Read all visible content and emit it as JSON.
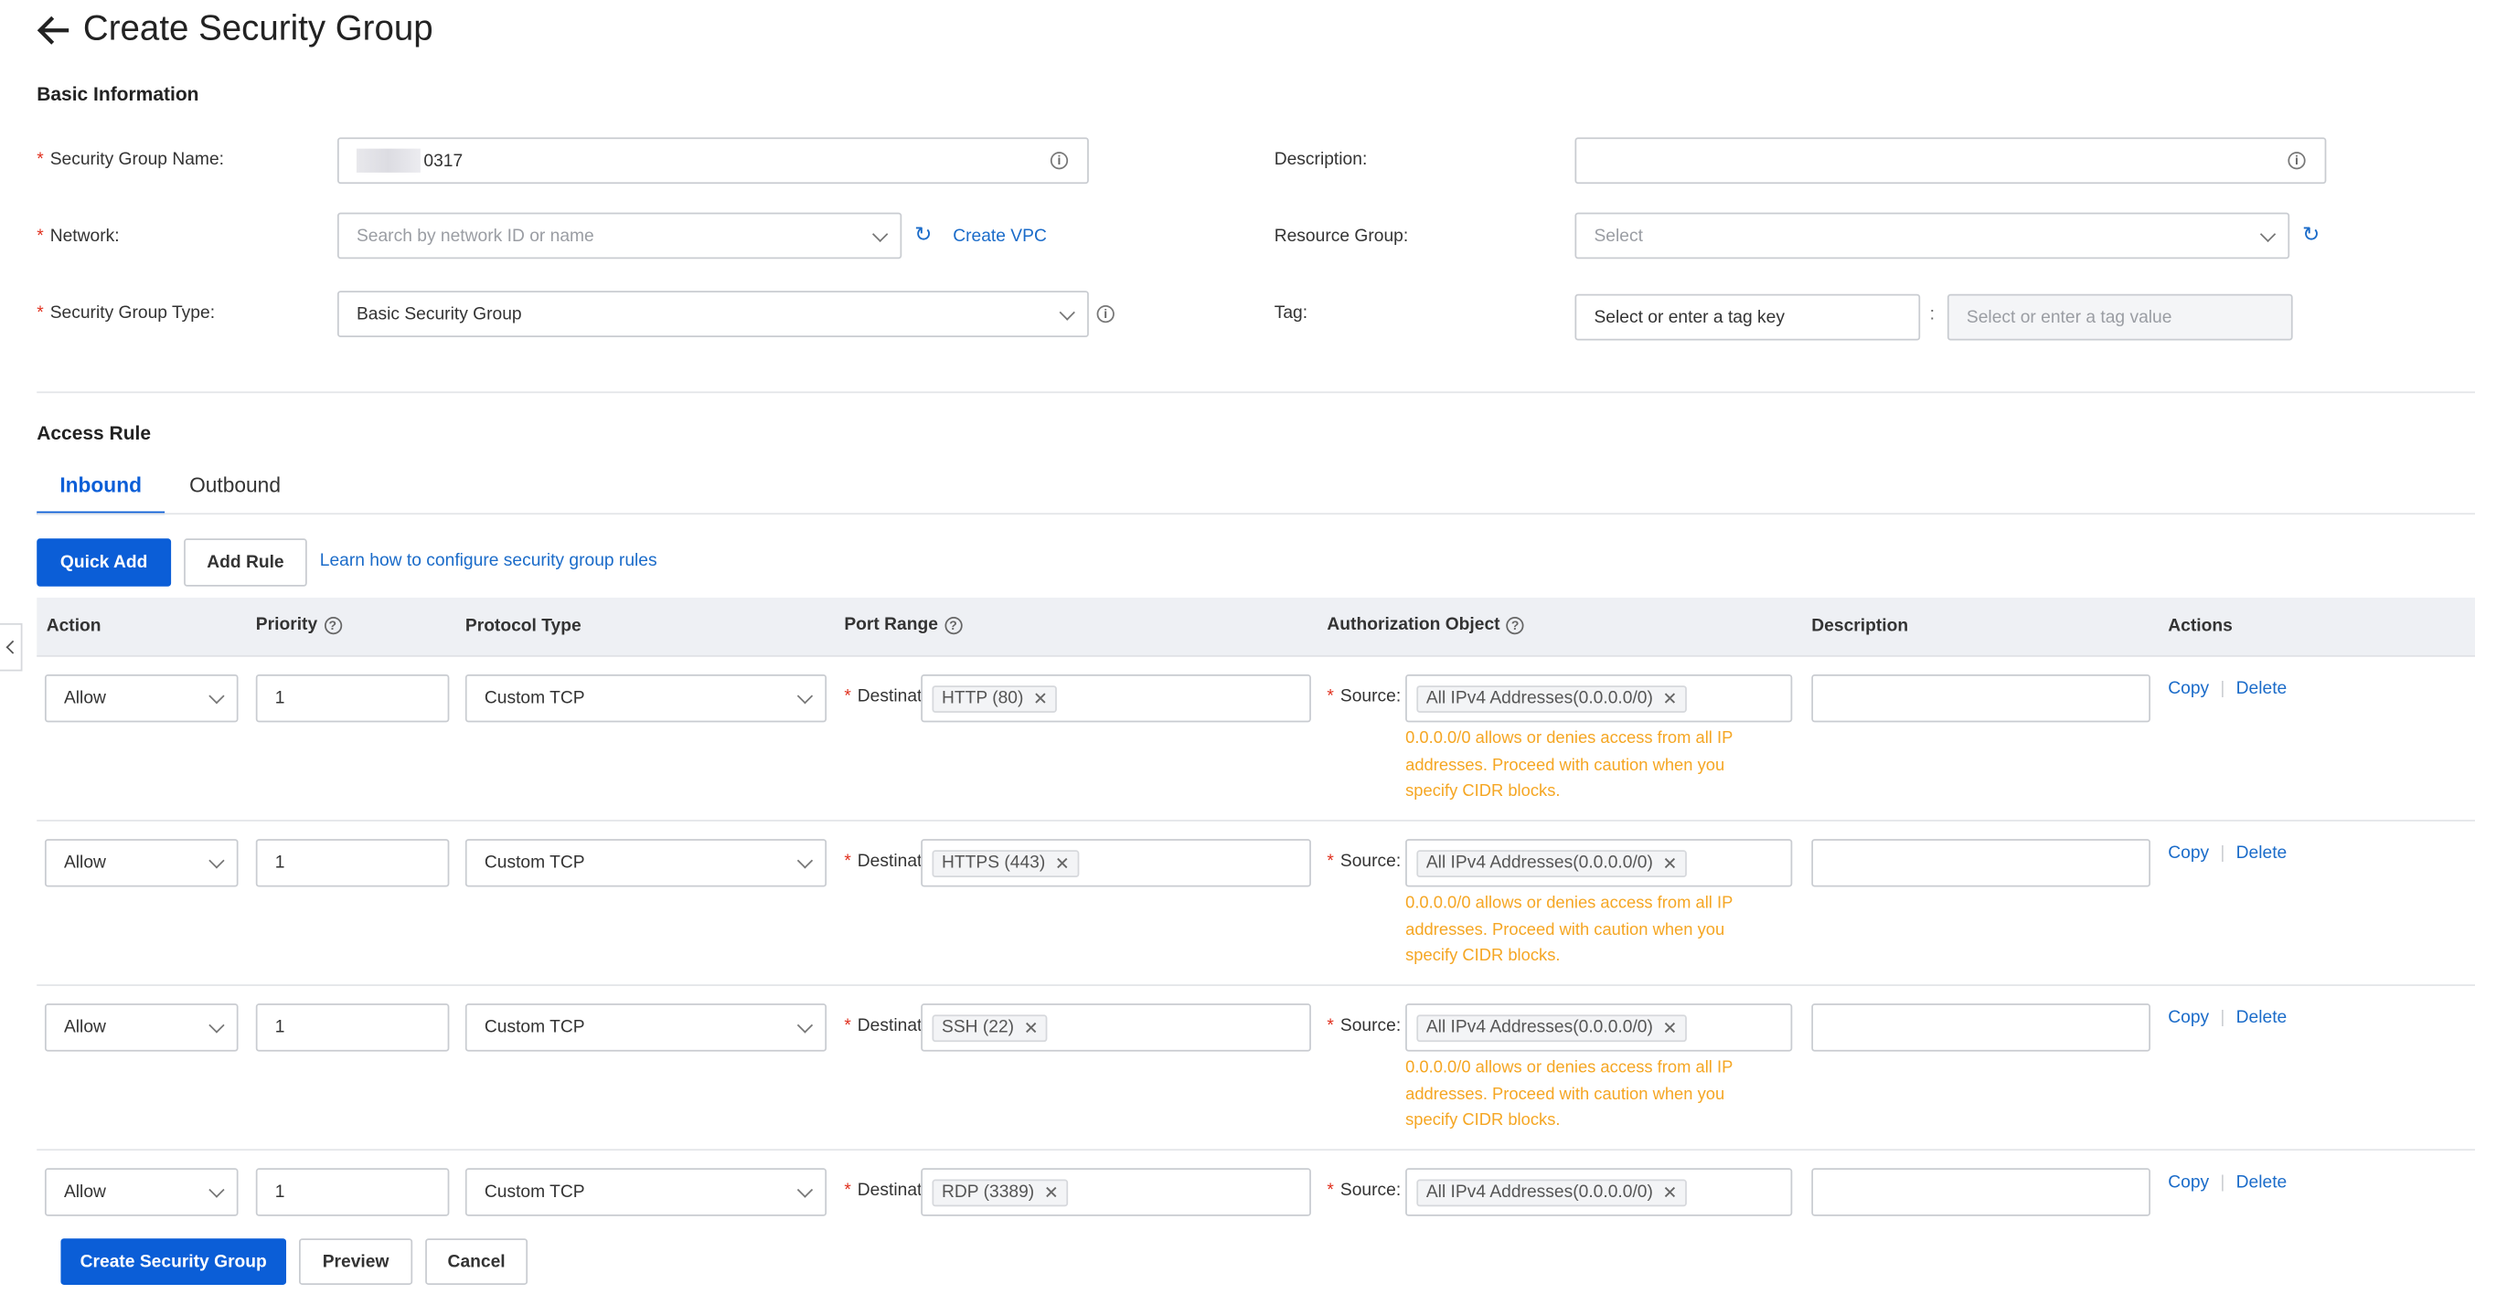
{
  "page": {
    "title": "Create Security Group"
  },
  "basic": {
    "title": "Basic Information",
    "sg_name_label": "Security Group Name",
    "sg_name_value": "0317",
    "description_label": "Description",
    "network_label": "Network",
    "network_placeholder": "Search by network ID or name",
    "create_vpc": "Create VPC",
    "resource_group_label": "Resource Group",
    "resource_group_placeholder": "Select",
    "sg_type_label": "Security Group Type",
    "sg_type_value": "Basic Security Group",
    "tag_label": "Tag",
    "tag_key_placeholder": "Select or enter a tag key",
    "tag_value_placeholder": "Select or enter a tag value"
  },
  "access": {
    "title": "Access Rule",
    "tabs": [
      "Inbound",
      "Outbound"
    ],
    "quick_add": "Quick Add",
    "add_rule": "Add Rule",
    "learn_link": "Learn how to configure security group rules"
  },
  "table": {
    "headers": {
      "action": "Action",
      "priority": "Priority",
      "protocol": "Protocol Type",
      "port": "Port Range",
      "auth": "Authorization Object",
      "description": "Description",
      "actions": "Actions"
    },
    "dest_label": "Destinat",
    "source_label": "Source",
    "copy": "Copy",
    "delete": "Delete",
    "warning": "0.0.0.0/0 allows or denies access from all IP addresses. Proceed with caution when you specify CIDR blocks.",
    "rows": [
      {
        "action": "Allow",
        "priority": "1",
        "protocol": "Custom TCP",
        "port": "HTTP (80)",
        "source": "All IPv4 Addresses(0.0.0.0/0)"
      },
      {
        "action": "Allow",
        "priority": "1",
        "protocol": "Custom TCP",
        "port": "HTTPS (443)",
        "source": "All IPv4 Addresses(0.0.0.0/0)"
      },
      {
        "action": "Allow",
        "priority": "1",
        "protocol": "Custom TCP",
        "port": "SSH (22)",
        "source": "All IPv4 Addresses(0.0.0.0/0)"
      },
      {
        "action": "Allow",
        "priority": "1",
        "protocol": "Custom TCP",
        "port": "RDP (3389)",
        "source": "All IPv4 Addresses(0.0.0.0/0)"
      }
    ]
  },
  "footer": {
    "create": "Create Security Group",
    "preview": "Preview",
    "cancel": "Cancel"
  }
}
